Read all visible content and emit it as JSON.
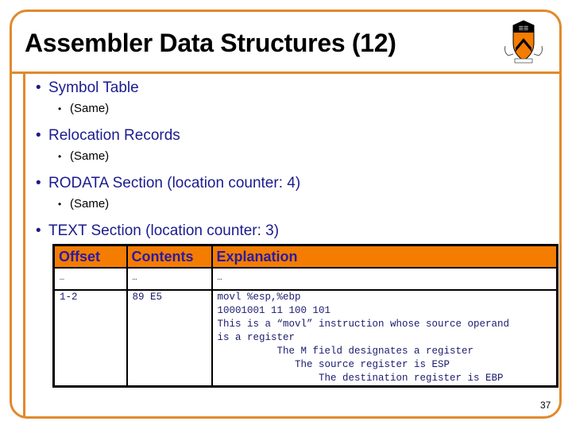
{
  "slide": {
    "title": "Assembler Data Structures (12)",
    "page_number": "37",
    "logo": "princeton-shield-logo",
    "accent_color": "#E08A2C",
    "header_fill": "#F47C00",
    "bullet_color": "#1B1B8F"
  },
  "bullets": [
    {
      "label": "Symbol Table",
      "sub": "(Same)"
    },
    {
      "label": "Relocation Records",
      "sub": "(Same)"
    },
    {
      "label": "RODATA Section (location counter: 4)",
      "sub": "(Same)"
    },
    {
      "label": "TEXT Section (location counter: 3)"
    }
  ],
  "bullet_glyph": "•",
  "table": {
    "headers": [
      "Offset",
      "Contents",
      "Explanation"
    ],
    "rows": [
      {
        "offset": "…",
        "contents": "…",
        "explanation": "…"
      },
      {
        "offset": "1-2",
        "contents": "89 E5",
        "explanation_lines": [
          "movl %esp,%ebp",
          "10001001 11 100 101",
          "This is a “movl” instruction whose source operand",
          "is a register",
          "          The M field designates a register",
          "             The source register is ESP",
          "                 The destination register is EBP"
        ]
      }
    ]
  }
}
